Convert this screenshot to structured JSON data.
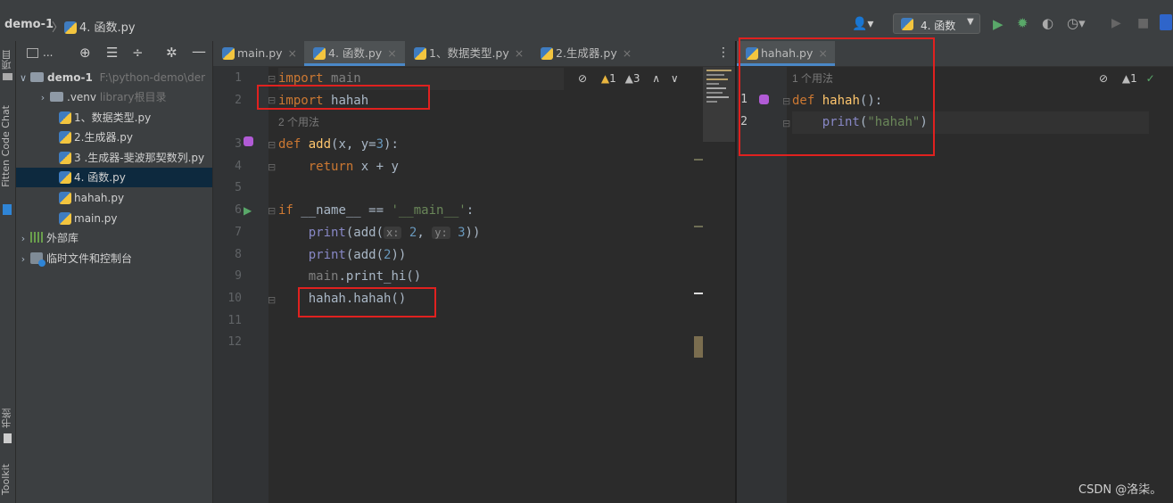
{
  "navbar": {
    "project": "demo-1",
    "file": "4. 函数.py",
    "run_config": "4. 函数"
  },
  "side_tools": {
    "project_label": "项目",
    "fitten_label": "Fitten Code Chat",
    "bookmarks_label": "书签",
    "toolkit_label": "Toolkit"
  },
  "project": {
    "title": "...",
    "root": {
      "name": "demo-1",
      "path": "F:\\python-demo\\der"
    },
    "items": [
      {
        "label": ".venv",
        "note": "library根目录"
      },
      {
        "label": "1、数据类型.py"
      },
      {
        "label": "2.生成器.py"
      },
      {
        "label": "3 .生成器-斐波那契数列.py"
      },
      {
        "label": "4. 函数.py"
      },
      {
        "label": "hahah.py"
      },
      {
        "label": "main.py"
      },
      {
        "label": "外部库"
      },
      {
        "label": "临时文件和控制台"
      }
    ]
  },
  "left_editor": {
    "tabs": [
      "main.py",
      "4. 函数.py",
      "1、数据类型.py",
      "2.生成器.py"
    ],
    "warnings": "1",
    "weak_warnings": "3",
    "usage_hint": "2 个用法",
    "line_numbers": [
      "1",
      "2",
      "3",
      "4",
      "5",
      "6",
      "7",
      "8",
      "9",
      "10",
      "11",
      "12"
    ],
    "code": {
      "l1_kw": "import",
      "l1_mod": "main",
      "l2_kw": "import",
      "l2_mod": "hahah",
      "l3_kw": "def",
      "l3_fn": "add",
      "l3_args": "(x, y=",
      "l3_num": "3",
      "l3_end": "):",
      "l4_kw": "return",
      "l4_expr": "x + y",
      "l6_kw": "if",
      "l6_cond": "__name__ == ",
      "l6_str": "'__main__'",
      "l6_end": ":",
      "l7_print": "print",
      "l7_a": "(add(",
      "l7_px": "x:",
      "l7_v1": "2",
      "l7_comma": ", ",
      "l7_py": "y:",
      "l7_v2": "3",
      "l7_end": "))",
      "l8_print": "print",
      "l8_a": "(add(",
      "l8_v": "2",
      "l8_end": "))",
      "l9_mod": "main",
      "l9_call": ".print_hi()",
      "l10_call": "hahah.hahah()"
    }
  },
  "right_editor": {
    "tab": "hahah.py",
    "warnings": "1",
    "usage_hint": "1 个用法",
    "line_numbers": [
      "1",
      "2"
    ],
    "code": {
      "l1_kw": "def",
      "l1_fn": "hahah",
      "l1_end": "():",
      "l2_print": "print",
      "l2_open": "(",
      "l2_str": "\"hahah\"",
      "l2_close": ")"
    }
  },
  "watermark": "CSDN @洛柒。",
  "colors": {
    "accent": "#4a88c7",
    "annotation": "#e0211f",
    "keyword": "#cc7832",
    "function": "#ffc66d",
    "string": "#6a8759",
    "number": "#6897bb"
  }
}
